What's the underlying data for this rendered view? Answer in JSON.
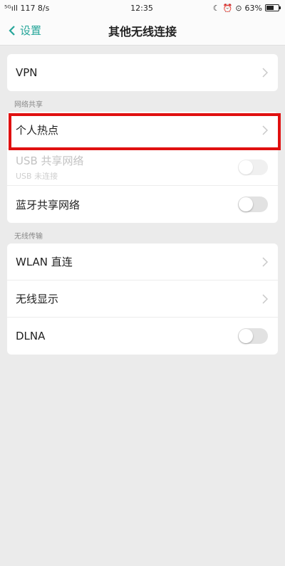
{
  "status_bar": {
    "left": "⁵ᴳıll 117 8/s",
    "time": "12:35",
    "battery": "63%",
    "battery_level": 0.63
  },
  "header": {
    "back_label": "设置",
    "title": "其他无线连接"
  },
  "vpn": {
    "label": "VPN"
  },
  "section_sharing": {
    "label": "网络共享",
    "hotspot_label": "个人热点",
    "usb_label": "USB 共享网络",
    "usb_sub": "USB 未连接",
    "bt_label": "蓝牙共享网络"
  },
  "section_transfer": {
    "label": "无线传输",
    "wlan_direct": "WLAN 直连",
    "wireless_display": "无线显示",
    "dlna": "DLNA"
  },
  "colors": {
    "accent": "#26a69a",
    "highlight": "#e01010"
  }
}
